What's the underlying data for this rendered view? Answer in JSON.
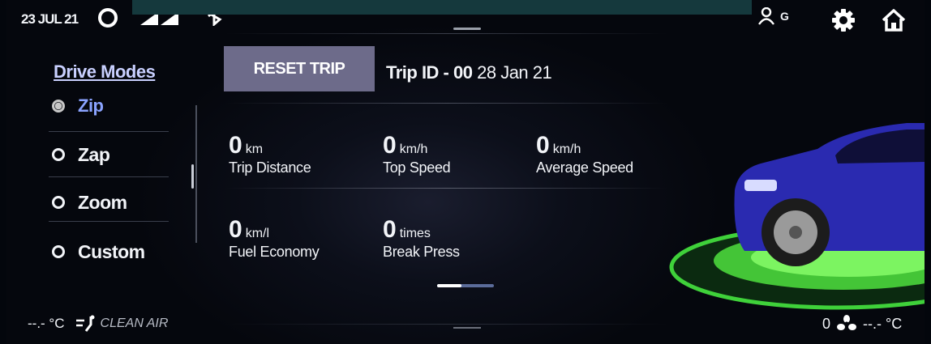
{
  "status": {
    "date": "23 JUL 21",
    "user_initial": "G"
  },
  "drive_modes": {
    "title": "Drive Modes",
    "items": [
      {
        "label": "Zip",
        "selected": true
      },
      {
        "label": "Zap",
        "selected": false
      },
      {
        "label": "Zoom",
        "selected": false
      },
      {
        "label": "Custom",
        "selected": false
      }
    ]
  },
  "trip": {
    "reset_label": "RESET TRIP",
    "id_label": "Trip ID - 00",
    "date": "28 Jan 21",
    "stats": [
      {
        "value": "0",
        "unit": "km",
        "label": "Trip Distance"
      },
      {
        "value": "0",
        "unit": "km/h",
        "label": "Top Speed"
      },
      {
        "value": "0",
        "unit": "km/h",
        "label": "Average Speed"
      },
      {
        "value": "0",
        "unit": "km/l",
        "label": "Fuel Economy"
      },
      {
        "value": "0",
        "unit": "times",
        "label": "Break Press"
      }
    ]
  },
  "climate": {
    "left_temp": "--.- °C",
    "clean_air_label": "CLEAN AIR",
    "fan_speed": "0",
    "right_temp": "--.- °C"
  },
  "colors": {
    "accent_selected": "#8aa3ff",
    "reset_button": "#6d6b8a",
    "car_body": "#2a2ab0",
    "ring_green": "#6cff4a"
  }
}
